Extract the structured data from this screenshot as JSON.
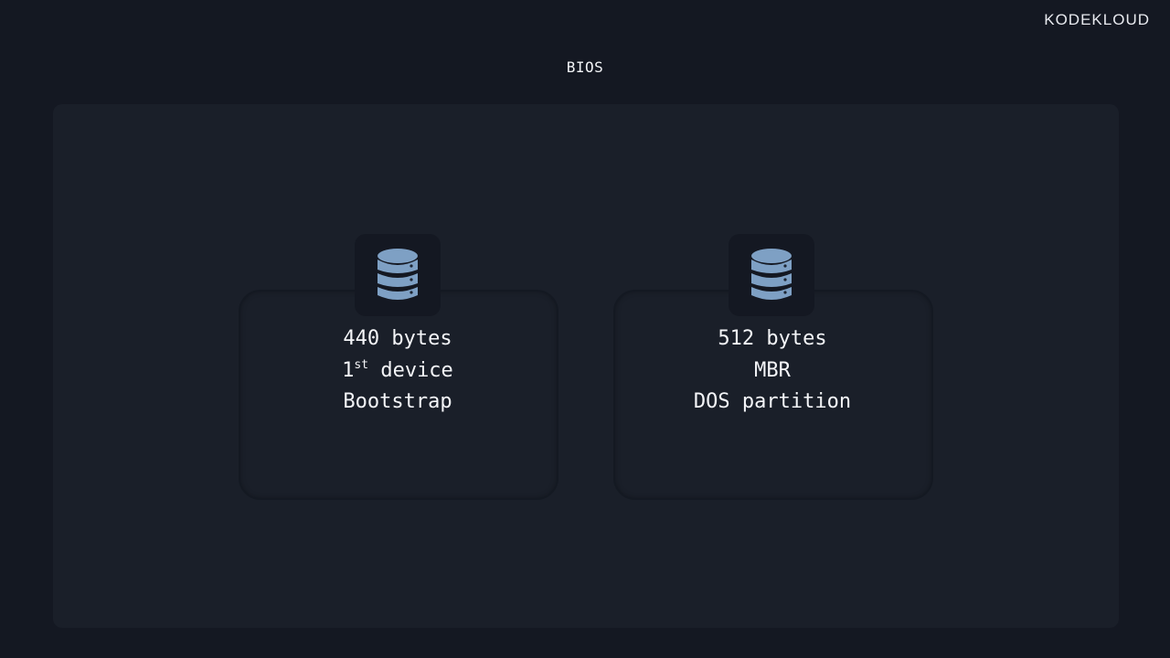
{
  "brand": {
    "logo_text": "KODEKLOUD"
  },
  "title": "BIOS",
  "cards": [
    {
      "icon": "database-icon",
      "lines": [
        "440 bytes",
        "device",
        "Bootstrap"
      ],
      "line2_prefix": "1",
      "line2_superscript": "st"
    },
    {
      "icon": "database-icon",
      "lines": [
        "512 bytes",
        "MBR",
        "DOS partition"
      ]
    }
  ],
  "colors": {
    "background": "#141822",
    "panel": "#1a1f29",
    "icon_fill": "#7ea0c4",
    "text": "#f4f5f8"
  }
}
